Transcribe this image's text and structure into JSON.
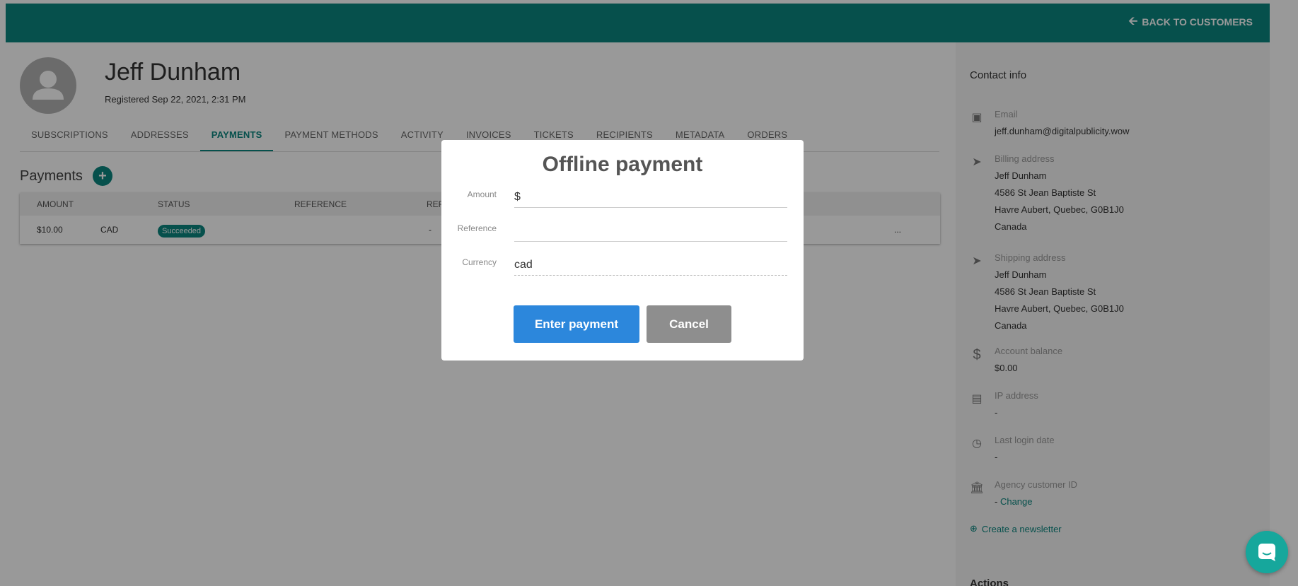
{
  "header": {
    "back_label": "BACK TO CUSTOMERS"
  },
  "customer": {
    "name": "Jeff Dunham",
    "registered": "Registered Sep 22, 2021, 2:31 PM"
  },
  "tabs": [
    {
      "label": "SUBSCRIPTIONS"
    },
    {
      "label": "ADDRESSES"
    },
    {
      "label": "PAYMENTS",
      "active": true
    },
    {
      "label": "PAYMENT METHODS"
    },
    {
      "label": "ACTIVITY"
    },
    {
      "label": "INVOICES"
    },
    {
      "label": "TICKETS"
    },
    {
      "label": "RECIPIENTS"
    },
    {
      "label": "METADATA"
    },
    {
      "label": "ORDERS"
    }
  ],
  "payments": {
    "title": "Payments",
    "add_label": "+",
    "columns": {
      "amount": "AMOUNT",
      "status": "STATUS",
      "reference": "REFERENCE",
      "ref_partial": "REF"
    },
    "rows": [
      {
        "amount": "$10.00",
        "currency": "CAD",
        "status": "Succeeded",
        "reference": "",
        "ref2": "-",
        "more": "..."
      }
    ]
  },
  "sidebar": {
    "contact_title": "Contact info",
    "email": {
      "label": "Email",
      "value": "jeff.dunham@digitalpublicity.wow"
    },
    "billing": {
      "label": "Billing address",
      "line1": "Jeff Dunham",
      "line2": "4586 St Jean Baptiste St",
      "line3": "Havre Aubert, Quebec, G0B1J0",
      "line4": "Canada"
    },
    "shipping": {
      "label": "Shipping address",
      "line1": "Jeff Dunham",
      "line2": "4586 St Jean Baptiste St",
      "line3": "Havre Aubert, Quebec, G0B1J0",
      "line4": "Canada"
    },
    "balance": {
      "label": "Account balance",
      "value": "$0.00"
    },
    "ip": {
      "label": "IP address",
      "value": "-"
    },
    "last_login": {
      "label": "Last login date",
      "value": "-"
    },
    "agency": {
      "label": "Agency customer ID",
      "value": "- ",
      "change": "Change"
    },
    "newsletter": "Create a newsletter",
    "actions_title": "Actions"
  },
  "modal": {
    "title": "Offline payment",
    "amount_label": "Amount",
    "amount_prefix": "$",
    "reference_label": "Reference",
    "reference_value": "",
    "currency_label": "Currency",
    "currency_value": "cad",
    "submit_label": "Enter payment",
    "cancel_label": "Cancel"
  },
  "colors": {
    "brand": "#0a857f",
    "primary_button": "#2c87dc",
    "cancel_button": "#8e8e8e"
  }
}
